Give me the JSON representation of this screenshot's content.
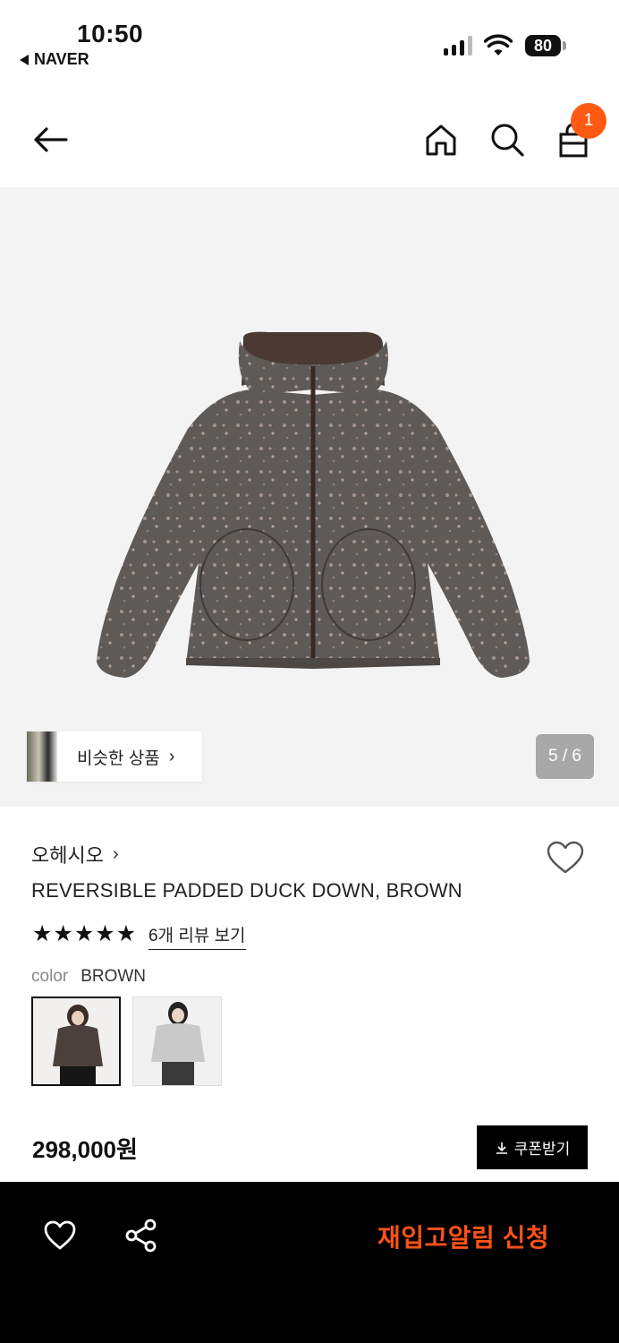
{
  "status_bar": {
    "time": "10:50",
    "back_app": "NAVER",
    "battery": "80"
  },
  "header": {
    "back_icon": "arrow-left-icon",
    "home_icon": "home-icon",
    "search_icon": "search-icon",
    "cart_icon": "shopping-bag-icon",
    "cart_count": "1"
  },
  "gallery": {
    "similar_label": "비슷한 상품",
    "similar_chevron": "›",
    "pager": "5 / 6"
  },
  "product": {
    "brand": "오헤시오",
    "brand_chevron": "›",
    "name": "REVERSIBLE PADDED DUCK DOWN, BROWN",
    "rating_stars": 5,
    "review_link": "6개 리뷰 보기",
    "color_key": "color",
    "color_value": "BROWN",
    "price": "298,000원",
    "coupon_label": "쿠폰받기"
  },
  "bottom_bar": {
    "restock_label": "재입고알림 신청"
  },
  "colors": {
    "accent": "#ff5a14",
    "restock_text": "#ff5316",
    "bottom_bg": "#000000"
  }
}
